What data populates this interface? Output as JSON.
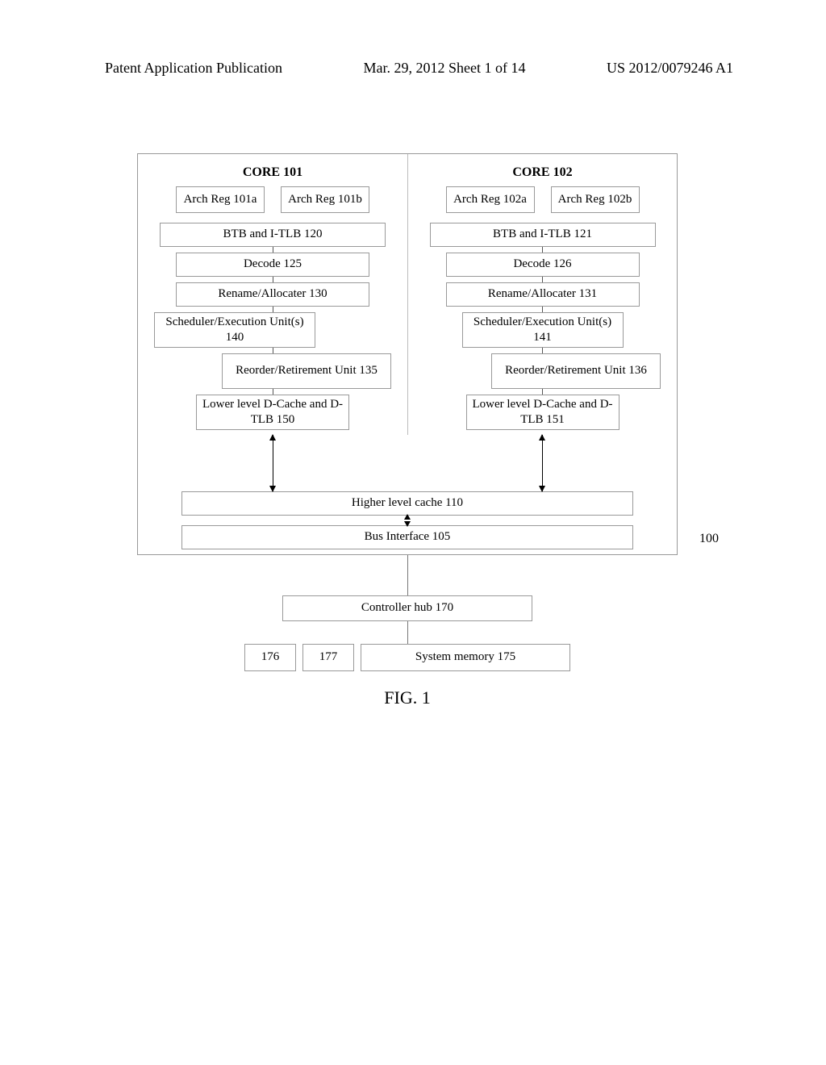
{
  "header": {
    "left": "Patent Application Publication",
    "center": "Mar. 29, 2012  Sheet 1 of 14",
    "right": "US 2012/0079246 A1"
  },
  "fig": {
    "core101": {
      "title": "CORE 101",
      "reg_a": "Arch Reg 101a",
      "reg_b": "Arch Reg 101b",
      "btb": "BTB and I-TLB 120",
      "decode": "Decode 125",
      "rename": "Rename/Allocater 130",
      "sched": "Scheduler/Execution Unit(s) 140",
      "reorder": "Reorder/Retirement Unit 135",
      "dcache": "Lower level D-Cache and D-TLB 150"
    },
    "core102": {
      "title": "CORE 102",
      "reg_a": "Arch Reg 102a",
      "reg_b": "Arch Reg 102b",
      "btb": "BTB and I-TLB 121",
      "decode": "Decode 126",
      "rename": "Rename/Allocater 131",
      "sched": "Scheduler/Execution Unit(s) 141",
      "reorder": "Reorder/Retirement Unit 136",
      "dcache": "Lower level D-Cache and D-TLB 151"
    },
    "higher_cache": "Higher level cache 110",
    "bus_if": "Bus Interface 105",
    "chip_label": "100",
    "ctrl_hub": "Controller hub 170",
    "mem176": "176",
    "mem177": "177",
    "sys_mem": "System memory 175",
    "caption": "FIG. 1"
  },
  "chart_data": {
    "type": "diagram",
    "title": "FIG. 1 — Dual-core processor block diagram",
    "nodes": [
      {
        "id": "100",
        "label": "Chip 100",
        "children": [
          "101",
          "102",
          "110",
          "105"
        ]
      },
      {
        "id": "101",
        "label": "CORE 101",
        "children": [
          "101a",
          "101b",
          "120",
          "125",
          "130",
          "140",
          "135",
          "150"
        ]
      },
      {
        "id": "102",
        "label": "CORE 102",
        "children": [
          "102a",
          "102b",
          "121",
          "126",
          "131",
          "141",
          "136",
          "151"
        ]
      },
      {
        "id": "101a",
        "label": "Arch Reg 101a"
      },
      {
        "id": "101b",
        "label": "Arch Reg 101b"
      },
      {
        "id": "102a",
        "label": "Arch Reg 102a"
      },
      {
        "id": "102b",
        "label": "Arch Reg 102b"
      },
      {
        "id": "120",
        "label": "BTB and I-TLB 120"
      },
      {
        "id": "121",
        "label": "BTB and I-TLB 121"
      },
      {
        "id": "125",
        "label": "Decode 125"
      },
      {
        "id": "126",
        "label": "Decode 126"
      },
      {
        "id": "130",
        "label": "Rename/Allocater 130"
      },
      {
        "id": "131",
        "label": "Rename/Allocater 131"
      },
      {
        "id": "140",
        "label": "Scheduler/Execution Unit(s) 140"
      },
      {
        "id": "141",
        "label": "Scheduler/Execution Unit(s) 141"
      },
      {
        "id": "135",
        "label": "Reorder/Retirement Unit 135"
      },
      {
        "id": "136",
        "label": "Reorder/Retirement Unit 136"
      },
      {
        "id": "150",
        "label": "Lower level D-Cache and D-TLB 150"
      },
      {
        "id": "151",
        "label": "Lower level D-Cache and D-TLB 151"
      },
      {
        "id": "110",
        "label": "Higher level cache 110"
      },
      {
        "id": "105",
        "label": "Bus Interface 105"
      },
      {
        "id": "170",
        "label": "Controller hub 170"
      },
      {
        "id": "175",
        "label": "System memory 175",
        "children": [
          "176",
          "177"
        ]
      },
      {
        "id": "176",
        "label": "176"
      },
      {
        "id": "177",
        "label": "177"
      }
    ],
    "edges": [
      [
        "120",
        "125"
      ],
      [
        "125",
        "130"
      ],
      [
        "130",
        "140"
      ],
      [
        "130",
        "135"
      ],
      [
        "135",
        "150"
      ],
      [
        "121",
        "126"
      ],
      [
        "126",
        "131"
      ],
      [
        "131",
        "141"
      ],
      [
        "131",
        "136"
      ],
      [
        "136",
        "151"
      ],
      [
        "150",
        "110"
      ],
      [
        "151",
        "110"
      ],
      [
        "110",
        "105"
      ],
      [
        "105",
        "170"
      ],
      [
        "170",
        "175"
      ]
    ]
  }
}
